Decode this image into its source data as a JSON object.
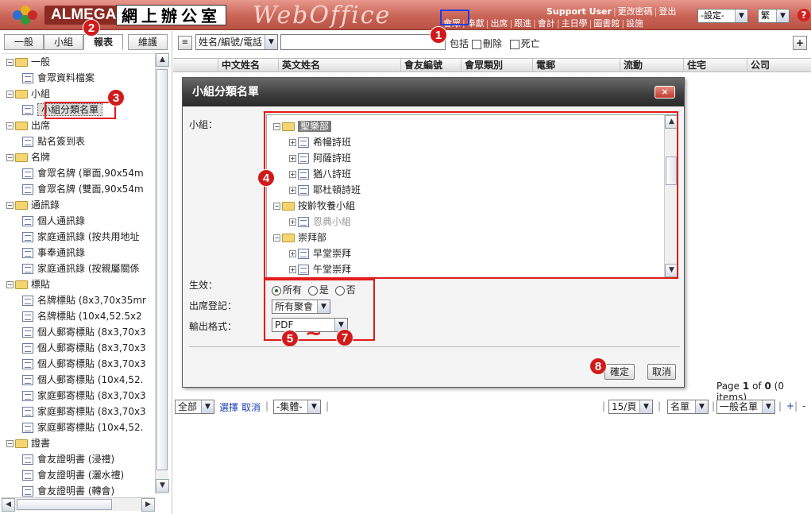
{
  "header": {
    "logo_text": "ALMEGA",
    "logo_cjk": "網上辦公室",
    "product": "WebOffice",
    "user": "Support User",
    "top_links": [
      "更改密碼",
      "登出"
    ],
    "nav_links": [
      "會眾",
      "奉獻",
      "出席",
      "跟進",
      "會計",
      "主日學",
      "圖書館",
      "設施"
    ],
    "settings_select": "-設定-",
    "lang_select": "繁",
    "help_icon": "?"
  },
  "left": {
    "tabs": [
      "一般",
      "小組",
      "報表",
      "維護"
    ],
    "active_tab": 2,
    "tree": [
      {
        "type": "folder",
        "label": "一般",
        "level": 0
      },
      {
        "type": "doc",
        "label": "會眾資料檔案",
        "level": 1
      },
      {
        "type": "folder",
        "label": "小組",
        "level": 0
      },
      {
        "type": "doc",
        "label": "小組分類名單",
        "level": 1,
        "selected": true
      },
      {
        "type": "folder",
        "label": "出席",
        "level": 0
      },
      {
        "type": "doc",
        "label": "點名簽到表",
        "level": 1
      },
      {
        "type": "folder",
        "label": "名牌",
        "level": 0
      },
      {
        "type": "doc",
        "label": "會眾名牌 (單面,90x54m",
        "level": 1
      },
      {
        "type": "doc",
        "label": "會眾名牌 (雙面,90x54m",
        "level": 1
      },
      {
        "type": "folder",
        "label": "通訊錄",
        "level": 0
      },
      {
        "type": "doc",
        "label": "個人通訊錄",
        "level": 1
      },
      {
        "type": "doc",
        "label": "家庭通訊錄 (按共用地址",
        "level": 1
      },
      {
        "type": "doc",
        "label": "事奉通訊錄",
        "level": 1
      },
      {
        "type": "doc",
        "label": "家庭通訊錄 (按親屬關係",
        "level": 1
      },
      {
        "type": "folder",
        "label": "標貼",
        "level": 0
      },
      {
        "type": "doc",
        "label": "名牌標貼 (8x3,70x35mr",
        "level": 1
      },
      {
        "type": "doc",
        "label": "名牌標貼 (10x4,52.5x2",
        "level": 1
      },
      {
        "type": "doc",
        "label": "個人郵寄標貼 (8x3,70x3",
        "level": 1
      },
      {
        "type": "doc",
        "label": "個人郵寄標貼 (8x3,70x3",
        "level": 1
      },
      {
        "type": "doc",
        "label": "個人郵寄標貼 (8x3,70x3",
        "level": 1
      },
      {
        "type": "doc",
        "label": "個人郵寄標貼 (10x4,52.",
        "level": 1
      },
      {
        "type": "doc",
        "label": "家庭郵寄標貼 (8x3,70x3",
        "level": 1
      },
      {
        "type": "doc",
        "label": "家庭郵寄標貼 (8x3,70x3",
        "level": 1
      },
      {
        "type": "doc",
        "label": "家庭郵寄標貼 (10x4,52.",
        "level": 1
      },
      {
        "type": "folder",
        "label": "證書",
        "level": 0
      },
      {
        "type": "doc",
        "label": "會友證明書 (浸禮)",
        "level": 1
      },
      {
        "type": "doc",
        "label": "會友證明書 (灑水禮)",
        "level": 1
      },
      {
        "type": "doc",
        "label": "會友證明書 (轉會)",
        "level": 1
      }
    ]
  },
  "main": {
    "search_field_select": "姓名/編號/電話",
    "search_value": "",
    "include_label": "包括",
    "deleted_label": "刪除",
    "deceased_label": "死亡",
    "add_button": "+",
    "columns": [
      "中文姓名",
      "英文姓名",
      "會友編號",
      "會眾類別",
      "電郵",
      "流動",
      "住宅",
      "公司"
    ],
    "pager_prefix": "Page",
    "pager_page": "1",
    "pager_of": "of",
    "pager_total": "0",
    "pager_items": "(0 items)",
    "scope_select": "全部",
    "select_link": "選擇",
    "cancel_link": "取消",
    "group_select": "-集體-",
    "per_page_select": "15/頁",
    "list_select": "名單",
    "general_list_select": "一般名單",
    "plus_link": "+",
    "minus_link": "-"
  },
  "dialog": {
    "title": "小組分類名單",
    "close": "×",
    "group_label": "小組：",
    "tree": [
      {
        "label": "聖樂部",
        "type": "folder",
        "level": 0,
        "highlight": true
      },
      {
        "label": "希幔詩班",
        "type": "doc",
        "level": 1
      },
      {
        "label": "阿薩詩班",
        "type": "doc",
        "level": 1
      },
      {
        "label": "猶八詩班",
        "type": "doc",
        "level": 1
      },
      {
        "label": "耶杜頓詩班",
        "type": "doc",
        "level": 1
      },
      {
        "label": "按齡牧養小組",
        "type": "folder",
        "level": 0
      },
      {
        "label": "恩典小組",
        "type": "doc",
        "level": 1,
        "dim": true
      },
      {
        "label": "崇拜部",
        "type": "folder",
        "level": 0
      },
      {
        "label": "早堂崇拜",
        "type": "doc",
        "level": 1
      },
      {
        "label": "午堂崇拜",
        "type": "doc",
        "level": 1
      }
    ],
    "effective_label": "生效：",
    "radio_all": "所有",
    "radio_yes": "是",
    "radio_no": "否",
    "attendance_label": "出席登記：",
    "attendance_select": "所有聚會",
    "format_label": "輸出格式：",
    "format_select": "PDF",
    "ok_button": "確定",
    "cancel_button": "取消"
  },
  "annotations": [
    "1",
    "2",
    "3",
    "4",
    "5",
    "7",
    "8"
  ]
}
